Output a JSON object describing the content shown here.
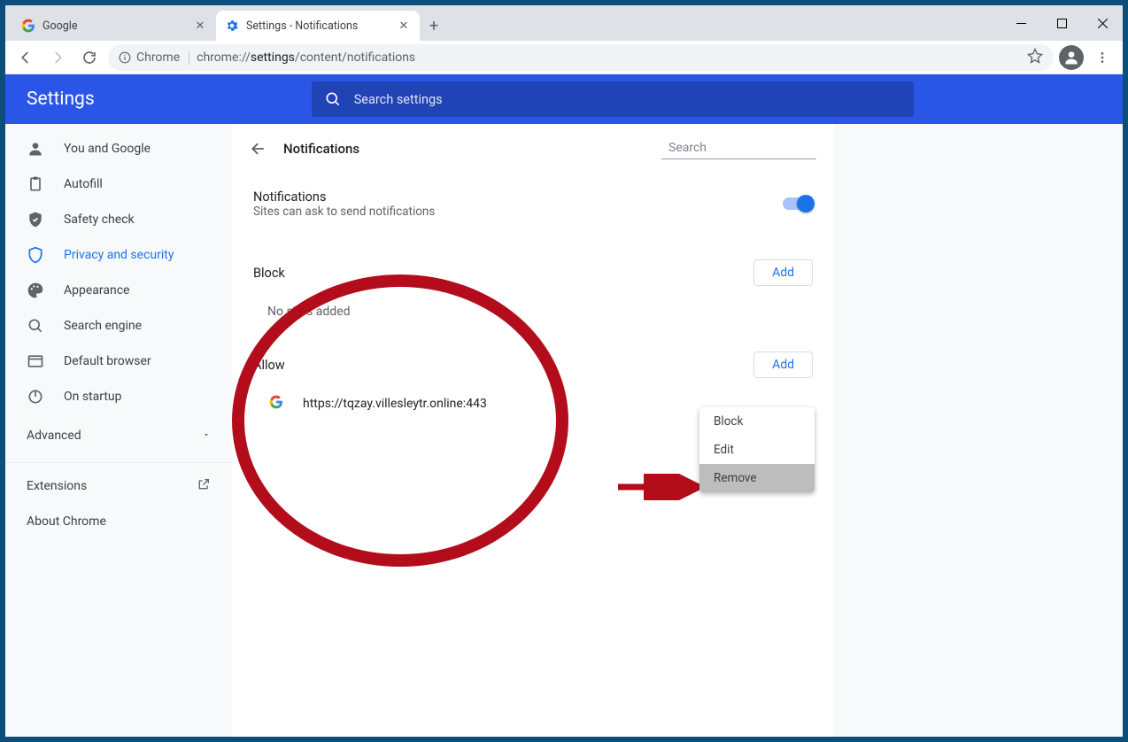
{
  "tabs": [
    {
      "label": "Google"
    },
    {
      "label": "Settings - Notifications"
    }
  ],
  "omnibox": {
    "chip": "Chrome",
    "url_prefix": "chrome://",
    "url_bold": "settings",
    "url_suffix": "/content/notifications"
  },
  "header": {
    "title": "Settings",
    "search_placeholder": "Search settings"
  },
  "sidebar": {
    "items": [
      {
        "label": "You and Google"
      },
      {
        "label": "Autofill"
      },
      {
        "label": "Safety check"
      },
      {
        "label": "Privacy and security"
      },
      {
        "label": "Appearance"
      },
      {
        "label": "Search engine"
      },
      {
        "label": "Default browser"
      },
      {
        "label": "On startup"
      }
    ],
    "advanced": "Advanced",
    "extensions": "Extensions",
    "about": "About Chrome"
  },
  "content": {
    "page_title": "Notifications",
    "sub_search_placeholder": "Search",
    "notif_heading": "Notifications",
    "notif_desc": "Sites can ask to send notifications",
    "block_heading": "Block",
    "add_button": "Add",
    "block_empty": "No sites added",
    "allow_heading": "Allow",
    "allow_sites": [
      {
        "url": "https://tqzay.villesleytr.online:443"
      }
    ]
  },
  "context_menu": {
    "items": [
      "Block",
      "Edit",
      "Remove"
    ],
    "highlighted": "Remove"
  }
}
